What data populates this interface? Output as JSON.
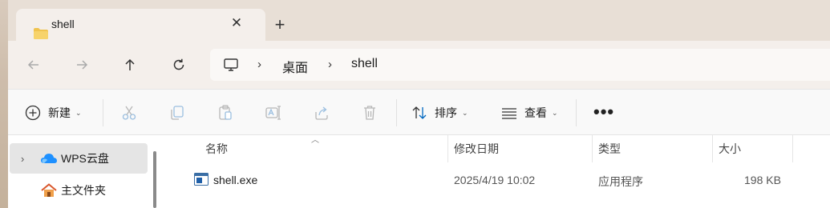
{
  "tab": {
    "title": "shell",
    "icon": "folder-icon",
    "close": "✕",
    "new_tab": "+"
  },
  "nav": {
    "back": "arrow-left-icon",
    "forward": "arrow-right-icon",
    "up": "arrow-up-icon",
    "refresh": "refresh-icon"
  },
  "address": {
    "root_icon": "computer-icon",
    "crumbs": [
      "桌面",
      "shell"
    ],
    "separator": "›"
  },
  "toolbar": {
    "new_label": "新建",
    "sort_label": "排序",
    "view_label": "查看",
    "more": "•••",
    "icons": [
      "cut-icon",
      "copy-icon",
      "paste-icon",
      "rename-icon",
      "share-icon",
      "delete-icon"
    ]
  },
  "sidebar": {
    "items": [
      {
        "label": "WPS云盘",
        "icon": "cloud-icon",
        "selected": true,
        "expandable": true
      },
      {
        "label": "主文件夹",
        "icon": "home-icon",
        "selected": false,
        "expandable": false
      }
    ]
  },
  "files": {
    "columns": [
      "名称",
      "修改日期",
      "类型",
      "大小"
    ],
    "sorted_by": "名称",
    "rows": [
      {
        "name": "shell.exe",
        "modified": "2025/4/19 10:02",
        "type": "应用程序",
        "size": "198 KB",
        "icon": "exe-icon"
      }
    ]
  },
  "colors": {
    "accent": "#0067c0",
    "folder": "#f0c34e",
    "cloud": "#1e90ff"
  }
}
